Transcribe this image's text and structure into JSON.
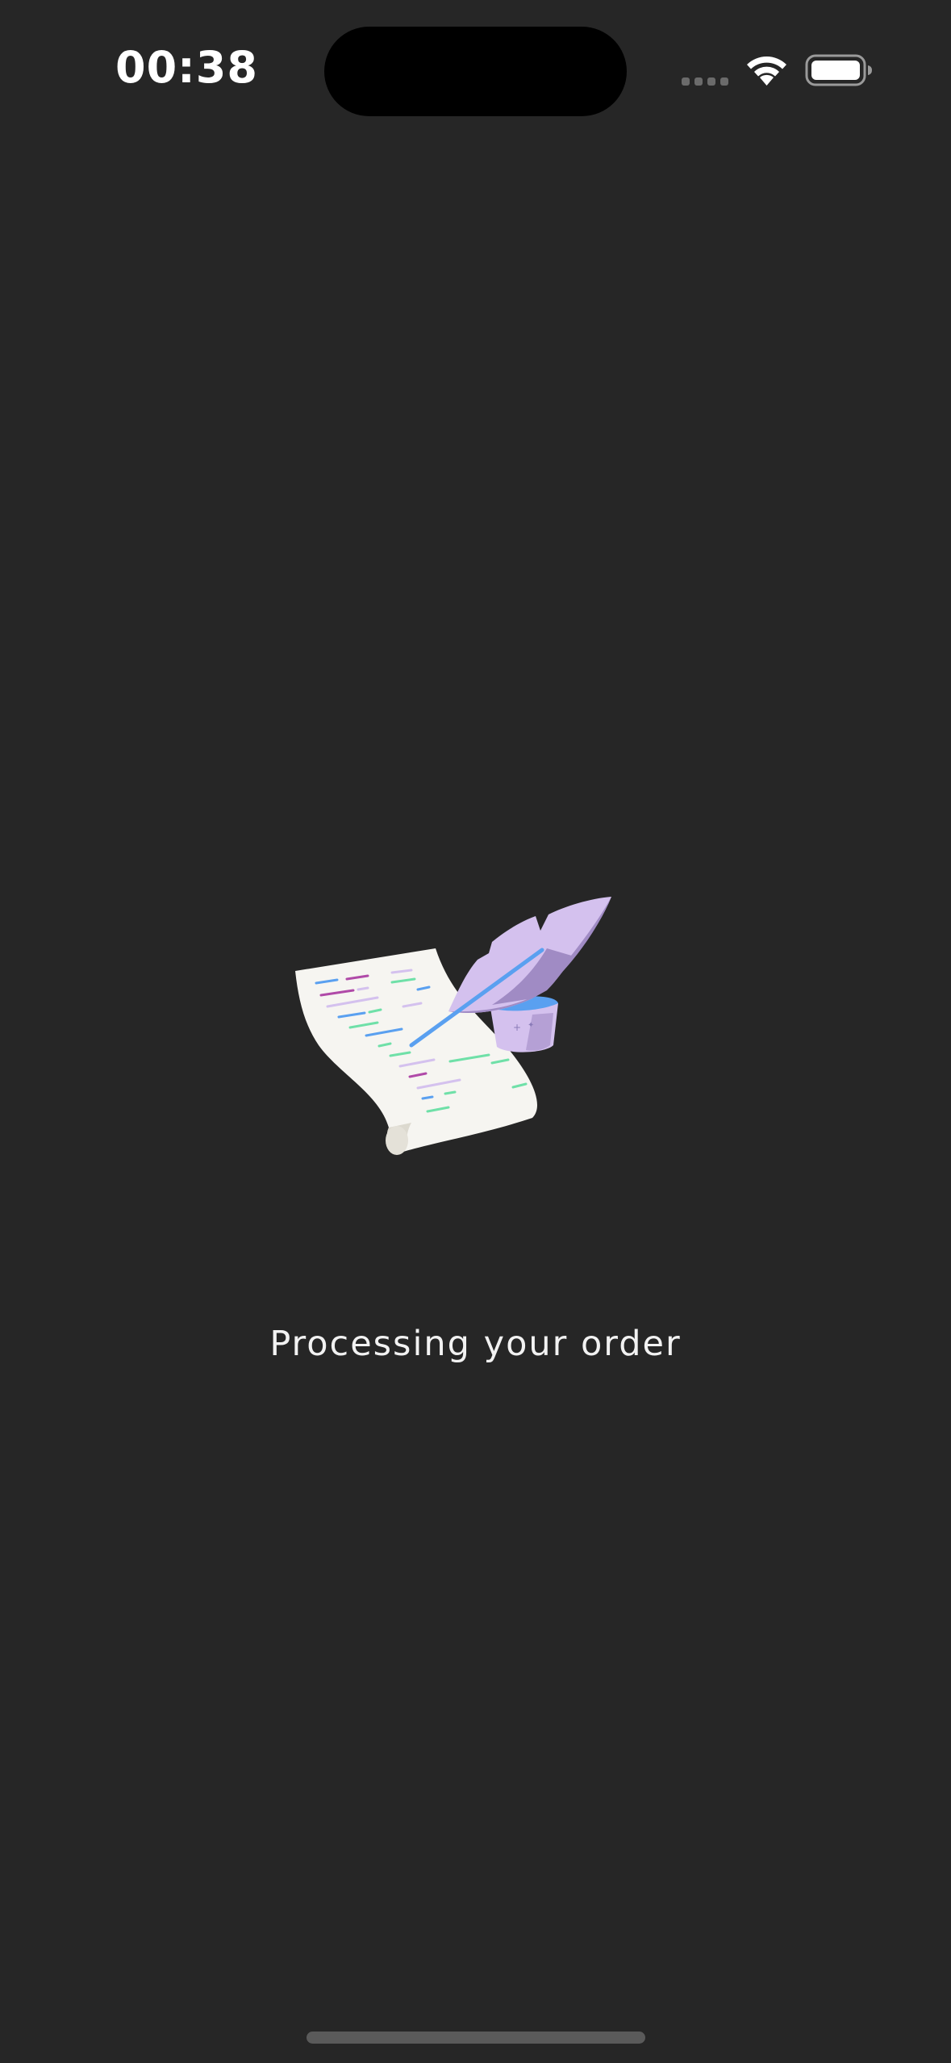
{
  "status_bar": {
    "time": "00:38"
  },
  "main": {
    "message": "Processing your order",
    "illustration_icon": "scroll-and-quill-icon"
  },
  "colors": {
    "background": "#262626",
    "paper": "#f6f5f1",
    "feather_light": "#d4c1ee",
    "feather_dark": "#a08bc4",
    "ink_blue": "#5aa0f0",
    "ink_green": "#6fe0a8",
    "ink_magenta": "#b04aa8"
  }
}
